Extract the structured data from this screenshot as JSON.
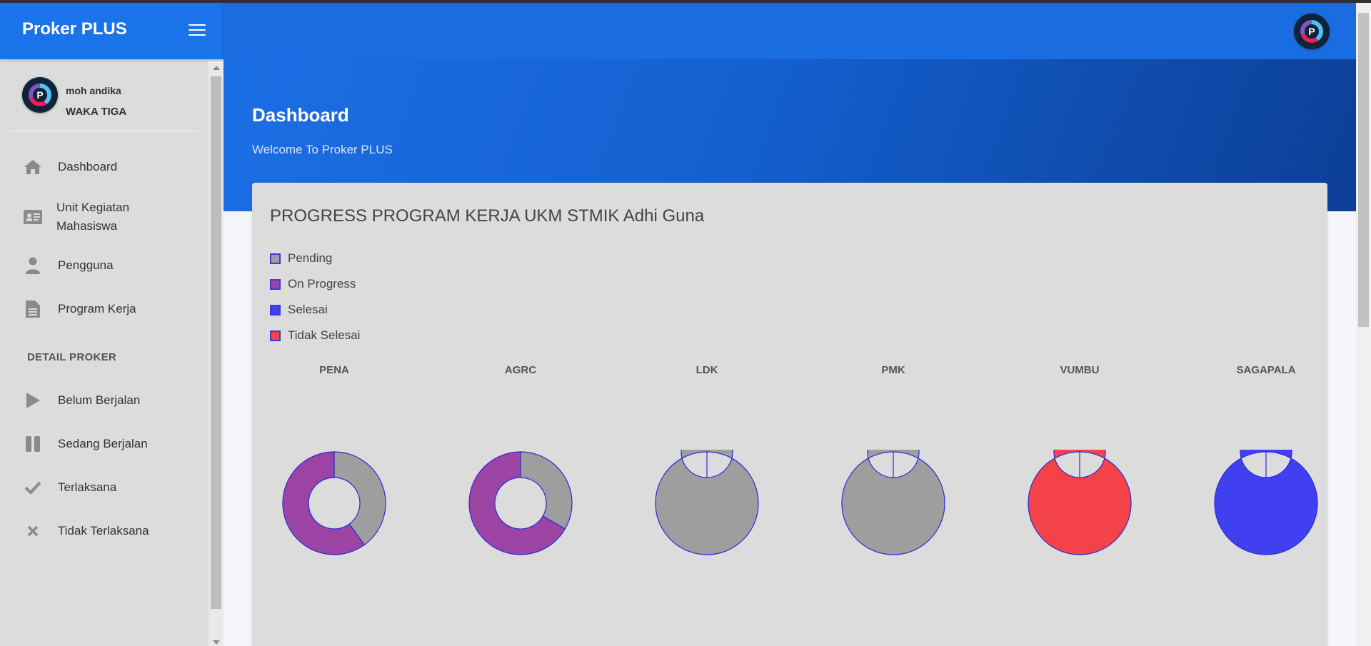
{
  "app": {
    "title": "Proker PLUS"
  },
  "user": {
    "name": "moh andika",
    "role": "WAKA TIGA",
    "avatar_letter": "P"
  },
  "sidebar": {
    "items": [
      {
        "label": "Dashboard",
        "icon": "home-icon"
      },
      {
        "label": "Unit Kegiatan\nMahasiswa",
        "label_line1": "Unit Kegiatan",
        "label_line2": "Mahasiswa",
        "icon": "id-card-icon"
      },
      {
        "label": "Pengguna",
        "icon": "user-icon"
      },
      {
        "label": "Program Kerja",
        "icon": "document-icon"
      }
    ],
    "section": "DETAIL PROKER",
    "detail_items": [
      {
        "label": "Belum Berjalan",
        "icon": "play-icon"
      },
      {
        "label": "Sedang Berjalan",
        "icon": "pause-icon"
      },
      {
        "label": "Terlaksana",
        "icon": "check-icon"
      },
      {
        "label": "Tidak Terlaksana",
        "icon": "close-icon"
      }
    ]
  },
  "hero": {
    "title": "Dashboard",
    "subtitle": "Welcome To Proker PLUS"
  },
  "colors": {
    "brand": "#1a73e8",
    "pending": "#9e9e9e",
    "on_progress": "#9c44a3",
    "selesai": "#4040f0",
    "tidak_selesai": "#f44348",
    "slice_border": "#2a2ad8"
  },
  "chart_data": {
    "type": "pie",
    "title": "PROGRESS PROGRAM KERJA UKM STMIK Adhi Guna",
    "legend": [
      "Pending",
      "On Progress",
      "Selesai",
      "Tidak Selesai"
    ],
    "legend_placement": "top-left",
    "charts": [
      {
        "name": "PENA",
        "values": {
          "Pending": 40,
          "On Progress": 60,
          "Selesai": 0,
          "Tidak Selesai": 0
        }
      },
      {
        "name": "AGRC",
        "values": {
          "Pending": 33.3,
          "On Progress": 66.7,
          "Selesai": 0,
          "Tidak Selesai": 0
        }
      },
      {
        "name": "LDK",
        "values": {
          "Pending": 100,
          "On Progress": 0,
          "Selesai": 0,
          "Tidak Selesai": 0
        }
      },
      {
        "name": "PMK",
        "values": {
          "Pending": 100,
          "On Progress": 0,
          "Selesai": 0,
          "Tidak Selesai": 0
        }
      },
      {
        "name": "VUMBU",
        "values": {
          "Pending": 0,
          "On Progress": 0,
          "Selesai": 0,
          "Tidak Selesai": 100
        }
      },
      {
        "name": "SAGAPALA",
        "values": {
          "Pending": 0,
          "On Progress": 0,
          "Selesai": 100,
          "Tidak Selesai": 0
        }
      }
    ]
  }
}
